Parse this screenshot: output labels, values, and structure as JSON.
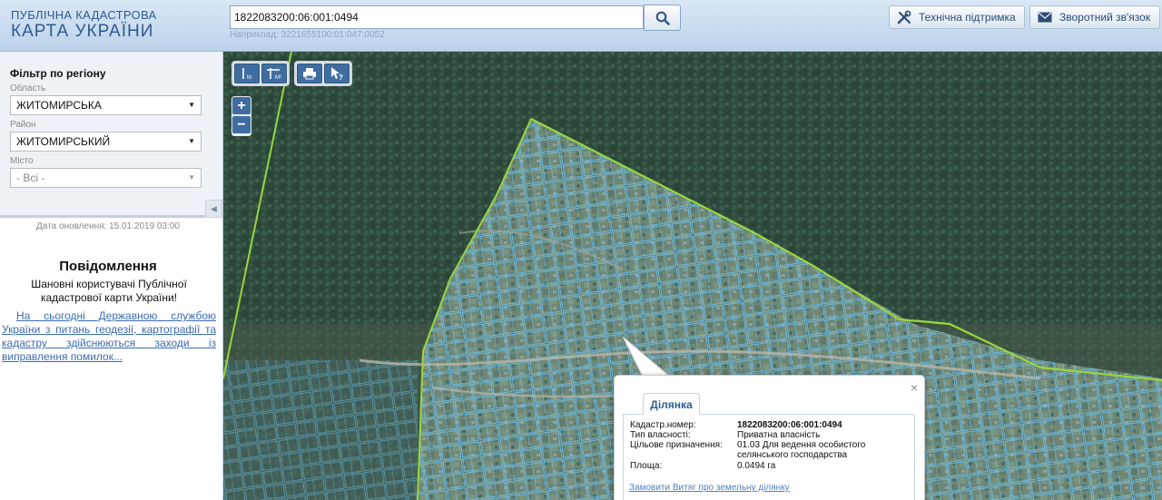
{
  "header": {
    "logo_line1": "ПУБЛІЧНА КАДАСТРОВА",
    "logo_line2": "КАРТА УКРАЇНИ",
    "search_value": "1822083200:06:001:0494",
    "search_example": "Наприклад: 3221655100:01:047:0052",
    "support_label": "Технічна підтримка",
    "feedback_label": "Зворотний зв'язок"
  },
  "sidebar": {
    "filter_title": "Фільтр по регіону",
    "oblast_label": "Область",
    "oblast_value": "ЖИТОМИРСЬКА",
    "rayon_label": "Район",
    "rayon_value": "ЖИТОМИРСЬКИЙ",
    "misto_label": "Місто",
    "misto_value": "- Всі -",
    "updated": "Дата оновлення: 15.01.2019 03:00",
    "message_title": "Повідомлення",
    "message_text": "Шановні користувачі Публічної кадастрової карти України!",
    "message_link": "На сьогодні Державною службою України з питань геодезії, картографії та кадастру здійснюються заходи із виправлення помилок..."
  },
  "map": {
    "zoom_in": "+",
    "zoom_out": "−",
    "popup": {
      "tab": "Ділянка",
      "rows": [
        {
          "key": "Кадастр.номер:",
          "value": "1822083200:06:001:0494"
        },
        {
          "key": "Тип власності:",
          "value": "Приватна власність"
        },
        {
          "key": "Цільове призначення:",
          "value": "01.03 Для ведення особистого селянського господарства"
        },
        {
          "key": "Площа:",
          "value": "0.0494 га"
        }
      ],
      "order_link": "Замовити Витяг про земельну ділянку",
      "close": "×"
    }
  },
  "colors": {
    "parcel_blue": "#6cc3f2",
    "boundary_green": "#9ad63a",
    "forest": "#2f4a3e",
    "link": "#3a6ab0"
  }
}
